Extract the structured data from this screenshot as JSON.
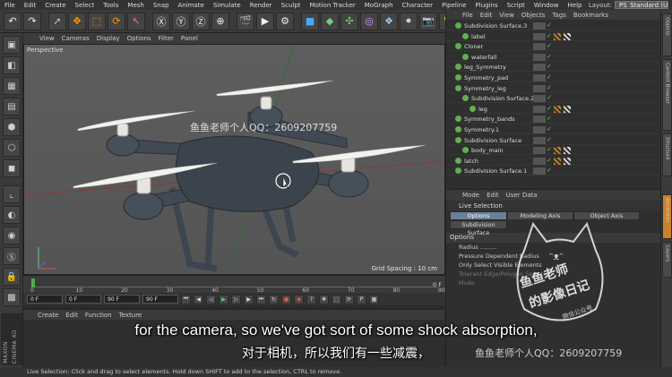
{
  "menubar": {
    "items": [
      "File",
      "Edit",
      "Create",
      "Select",
      "Tools",
      "Mesh",
      "Snap",
      "Animate",
      "Simulate",
      "Render",
      "Sculpt",
      "Motion Tracker",
      "MoGraph",
      "Character",
      "Pipeline",
      "Plugins",
      "Script",
      "Window",
      "Help"
    ],
    "layout_label": "Layout:",
    "layout_value": "PS_Standard (User)"
  },
  "toolbar": {
    "icons": [
      "undo-icon",
      "redo-icon",
      "live-selection-icon",
      "move-icon",
      "scale-icon",
      "rotate-icon",
      "select-arrow-icon",
      "x-axis-icon",
      "y-axis-icon",
      "z-axis-icon",
      "world-coordinate-icon",
      "render-view-icon",
      "render-picture-queue-icon",
      "render-settings-icon",
      "cube-primitive-icon",
      "subdivision-surface-icon",
      "array-icon",
      "spline-icon",
      "deformer-icon",
      "environment-icon",
      "camera-icon",
      "light-icon"
    ]
  },
  "viewport": {
    "menu": [
      "View",
      "Cameras",
      "Display",
      "Options",
      "Filter",
      "Panel"
    ],
    "label": "Perspective",
    "grid_spacing": "Grid Spacing : 10 cm"
  },
  "timeline": {
    "ticks": [
      "0",
      "10",
      "20",
      "30",
      "40",
      "50",
      "60",
      "70",
      "80",
      "90"
    ],
    "frame_indicator": "0 F"
  },
  "transport": {
    "start_field": "0 F",
    "current_field": "0 F",
    "end_field": "90 F",
    "max_field": "90 F"
  },
  "materials": {
    "menu": [
      "Create",
      "Edit",
      "Function",
      "Texture"
    ]
  },
  "objects": {
    "menu": [
      "File",
      "Edit",
      "View",
      "Objects",
      "Tags",
      "Bookmarks"
    ],
    "rows": [
      {
        "label": "Subdivision Surface.3",
        "indent": 0,
        "tags": 0
      },
      {
        "label": "label",
        "indent": 1,
        "tags": 2
      },
      {
        "label": "Cloner",
        "indent": 0,
        "tags": 0
      },
      {
        "label": "waterfall",
        "indent": 1,
        "tags": 0
      },
      {
        "label": "leg_Symmetry",
        "indent": 0,
        "tags": 0
      },
      {
        "label": "Symmetry_pad",
        "indent": 0,
        "tags": 0
      },
      {
        "label": "Symmetry_leg",
        "indent": 0,
        "tags": 0
      },
      {
        "label": "Subdivision Surface.2",
        "indent": 1,
        "tags": 0
      },
      {
        "label": "leg",
        "indent": 2,
        "tags": 2
      },
      {
        "label": "Symmetry_bands",
        "indent": 0,
        "tags": 0
      },
      {
        "label": "Symmetry.1",
        "indent": 0,
        "tags": 0
      },
      {
        "label": "Subdivision Surface",
        "indent": 0,
        "tags": 0
      },
      {
        "label": "body_main",
        "indent": 1,
        "tags": 2
      },
      {
        "label": "latch",
        "indent": 0,
        "tags": 2
      },
      {
        "label": "Subdivision Surface.1",
        "indent": 0,
        "tags": 0
      }
    ]
  },
  "attributes": {
    "menu": [
      "Mode",
      "Edit",
      "User Data"
    ],
    "title": "Live Selection",
    "tabs": [
      "Options",
      "Modeling Axis",
      "Object Axis",
      "Subdivision Surface"
    ],
    "section": "Options",
    "rows": [
      "Radius .........",
      "Pressure Dependent Radius",
      "Only Select Visible Elements",
      "Tolerant Edge/Polygon Selection",
      "Mode"
    ]
  },
  "side_tabs": [
    "Objects",
    "Content Browser",
    "Structure",
    "Attributes",
    "Layers"
  ],
  "statusbar": {
    "text": "Live Selection: Click and drag to select elements. Hold down SHIFT to add to the selection, CTRL to remove."
  },
  "branding": {
    "maxon": "MAXON",
    "product": "CINEMA 4D"
  },
  "overlay": {
    "subtitle_en": "for the camera, so we've got sort of some shock absorption,",
    "subtitle_zh": "对于相机，所以我们有一些减震，",
    "watermark_center": "鱼鱼老师个人QQ：2609207759",
    "watermark_bottom": "鱼鱼老师个人QQ：2609207759",
    "badge_line1": "鱼鱼老师",
    "badge_line2": "的影像日记",
    "badge_small": "微信公众号"
  }
}
